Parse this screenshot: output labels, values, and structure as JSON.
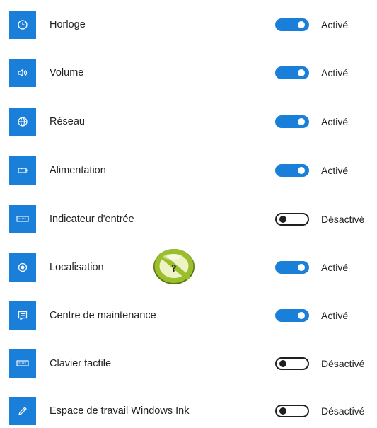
{
  "accent_color": "#1a7fd8",
  "items": [
    {
      "label": "Horloge",
      "icon": "clock-icon",
      "state": "Activé",
      "on": true
    },
    {
      "label": "Volume",
      "icon": "speaker-icon",
      "state": "Activé",
      "on": true
    },
    {
      "label": "Réseau",
      "icon": "globe-icon",
      "state": "Activé",
      "on": true
    },
    {
      "label": "Alimentation",
      "icon": "battery-icon",
      "state": "Activé",
      "on": true
    },
    {
      "label": "Indicateur d'entrée",
      "icon": "keyboard-icon",
      "state": "Désactivé",
      "on": false
    },
    {
      "label": "Localisation",
      "icon": "location-icon",
      "state": "Activé",
      "on": true
    },
    {
      "label": "Centre de maintenance",
      "icon": "action-center-icon",
      "state": "Activé",
      "on": true
    },
    {
      "label": "Clavier tactile",
      "icon": "keyboard-icon",
      "state": "Désactivé",
      "on": false
    },
    {
      "label": "Espace de travail Windows Ink",
      "icon": "pen-icon",
      "state": "Désactivé",
      "on": false
    }
  ],
  "overlay_badge": {
    "icon": "no-entry-icon",
    "text": "?"
  }
}
